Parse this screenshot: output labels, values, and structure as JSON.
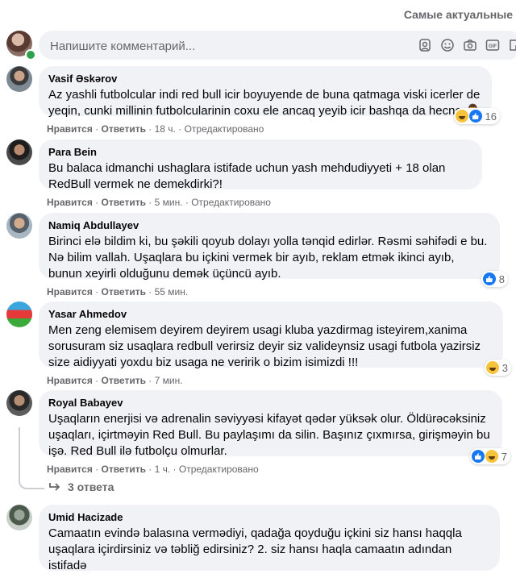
{
  "sort": {
    "label": "Самые актуальные"
  },
  "composer": {
    "placeholder": "Напишите комментарий..."
  },
  "actions": {
    "like": "Нравится",
    "reply": "Ответить",
    "edited": "Отредактировано"
  },
  "comments": [
    {
      "author": "Vasif Əskərov",
      "text": "Az yashli futbolcular indi red bull icir boyuyende de buna qatmaga viski icerler de yeqin, cunki millinin futbolcularinin coxu ele ancaq yeyib icir bashqa da hecne 🤦‍♂️",
      "time": "18 ч.",
      "edited": true,
      "reactions": [
        "haha",
        "like"
      ],
      "reaction_count": "16"
    },
    {
      "author": "Para Bein",
      "text": "Bu balaca idmanchi ushaglara istifade uchun yash mehdudiyyeti + 18 olan RedBull vermek ne demekdirki?!",
      "time": "5 мин.",
      "edited": true,
      "reactions": [],
      "reaction_count": ""
    },
    {
      "author": "Namiq Abdullayev",
      "text": "Birinci elə bildim ki, bu şəkili qoyub dolayı yolla tənqid edirlər. Rəsmi səhifədi e bu. Nə bilim vallah. Uşaqlara bu içkini vermek bir ayıb, reklam etmək ikinci ayıb, bunun xeyirli olduğunu demək üçüncü ayıb.",
      "time": "55 мин.",
      "edited": false,
      "reactions": [
        "like"
      ],
      "reaction_count": "8"
    },
    {
      "author": "Yasar Ahmedov",
      "text": "Men zeng elemisem deyirem deyirem usagi kluba yazdirmag isteyirem,xanima sorusuram siz usaqlara redbull verirsiz deyir siz valideynsiz usagi futbola yazirsiz size aidiyyati yoxdu biz usaga ne veririk o bizim isimizdi !!!",
      "time": "7 мин.",
      "edited": false,
      "reactions": [
        "haha"
      ],
      "reaction_count": "3"
    },
    {
      "author": "Royal Babayev",
      "text": "Uşaqların enerjisi və adrenalin səviyyəsi kifayət qədər yüksək olur. Öldürəcəksiniz uşaqları, içirtməyin Red Bull. Bu paylaşımı da silin. Başınız çıxmırsa, girişməyin bu işə. Red Bull ilə futbolçu olmurlar.",
      "time": "1 ч.",
      "edited": true,
      "reactions": [
        "like",
        "haha"
      ],
      "reaction_count": "7"
    },
    {
      "author": "Umid Hacizade",
      "text": "Camaatın evində balasına vermədiyi, qadağa qoyduğu içkini siz hansı haqqla uşaqlara içirdirsiniz və təbliğ edirsiniz? 2. siz hansı haqla camaatın adından istifadə",
      "time": "",
      "edited": false,
      "reactions": [],
      "reaction_count": ""
    }
  ],
  "replies": {
    "label": "3 ответа"
  }
}
